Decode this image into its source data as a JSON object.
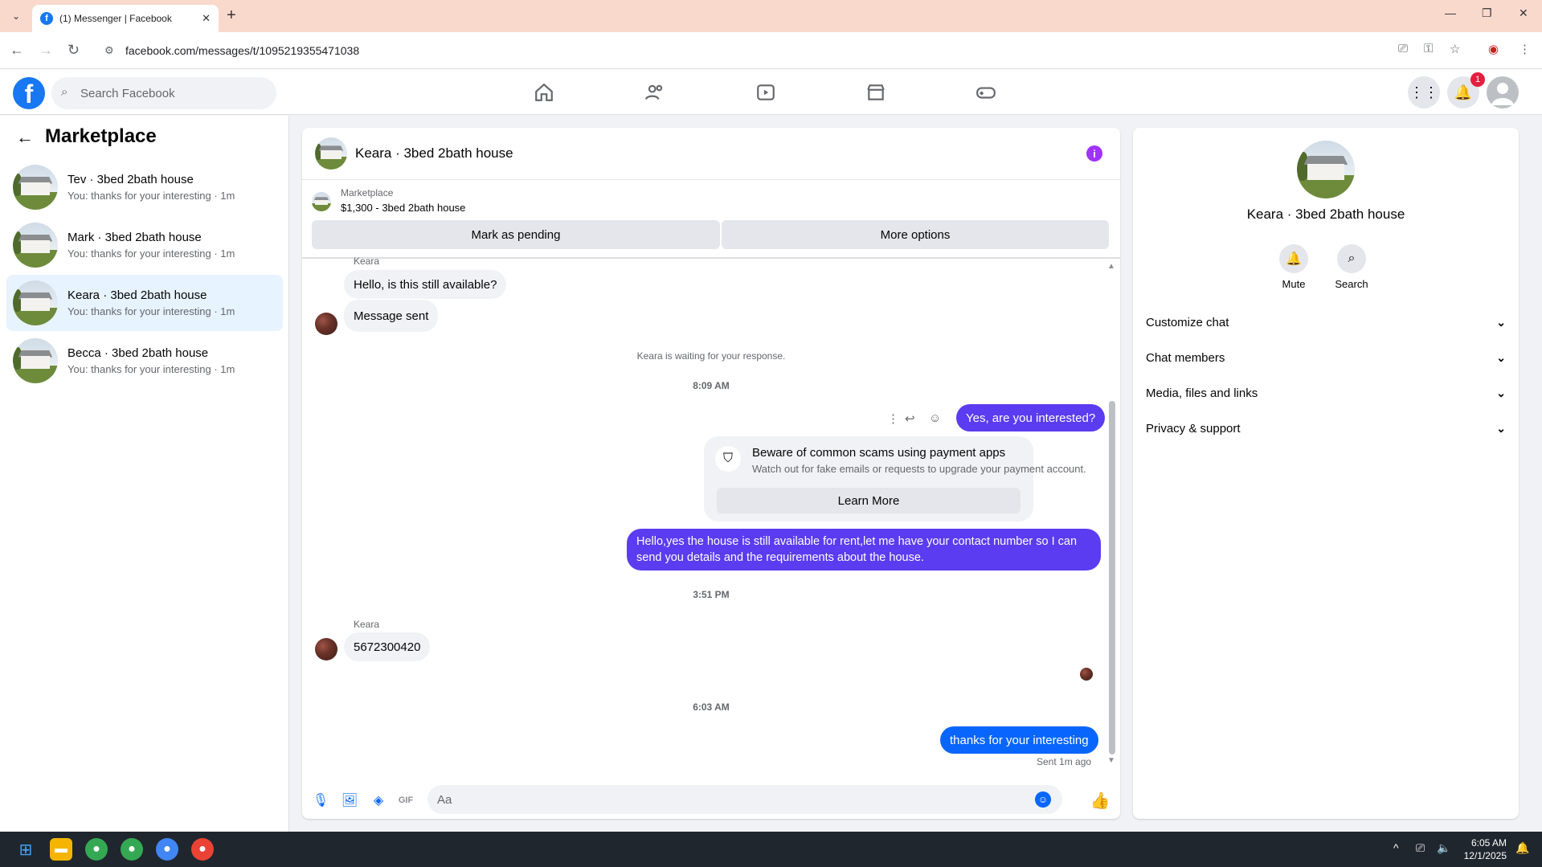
{
  "browser": {
    "tab_title": "(1) Messenger | Facebook",
    "url": "facebook.com/messages/t/1095219355471038"
  },
  "facebook": {
    "search_placeholder": "Search Facebook",
    "notification_count": "1",
    "brand_color": "#1877f2"
  },
  "left": {
    "title": "Marketplace",
    "conversations": [
      {
        "name": "Tev · 3bed 2bath house",
        "preview": "You: thanks for your interesting · 1m",
        "active": false
      },
      {
        "name": "Mark · 3bed 2bath house",
        "preview": "You: thanks for your interesting · 1m",
        "active": false
      },
      {
        "name": "Keara · 3bed 2bath house",
        "preview": "You: thanks for your interesting · 1m",
        "active": true
      },
      {
        "name": "Becca · 3bed 2bath house",
        "preview": "You: thanks for your interesting · 1m",
        "active": false
      }
    ]
  },
  "chat": {
    "title": "Keara · 3bed 2bath house",
    "marketplace_label": "Marketplace",
    "listing": "$1,300 - 3bed 2bath house",
    "mark_pending": "Mark as pending",
    "more_options": "More options",
    "sender_top": "Keara",
    "msg1": "Hello, is this still available?",
    "msg2": "Message sent",
    "waiting": "Keara is waiting for your response.",
    "time1": "8:09 AM",
    "out1": "Yes, are you interested?",
    "warning_title": "Beware of common scams using payment apps",
    "warning_sub": "Watch out for fake emails or requests to upgrade your payment account.",
    "learn_more": "Learn More",
    "out2": "Hello,yes the house is still available for rent,let me have your contact number   so I can send you details and the requirements about the house.",
    "time2": "3:51 PM",
    "sender2": "Keara",
    "msg3": "5672300420",
    "time3": "6:03 AM",
    "out3": "thanks for your interesting",
    "sent_status": "Sent 1m ago",
    "composer_placeholder": "Aa",
    "outgoing_color": "#5b3cf0"
  },
  "right": {
    "name": "Keara · 3bed 2bath house",
    "mute": "Mute",
    "search": "Search",
    "rows": [
      "Customize chat",
      "Chat members",
      "Media, files and links",
      "Privacy & support"
    ]
  },
  "taskbar": {
    "time": "6:05 AM",
    "date": "12/1/2025"
  }
}
